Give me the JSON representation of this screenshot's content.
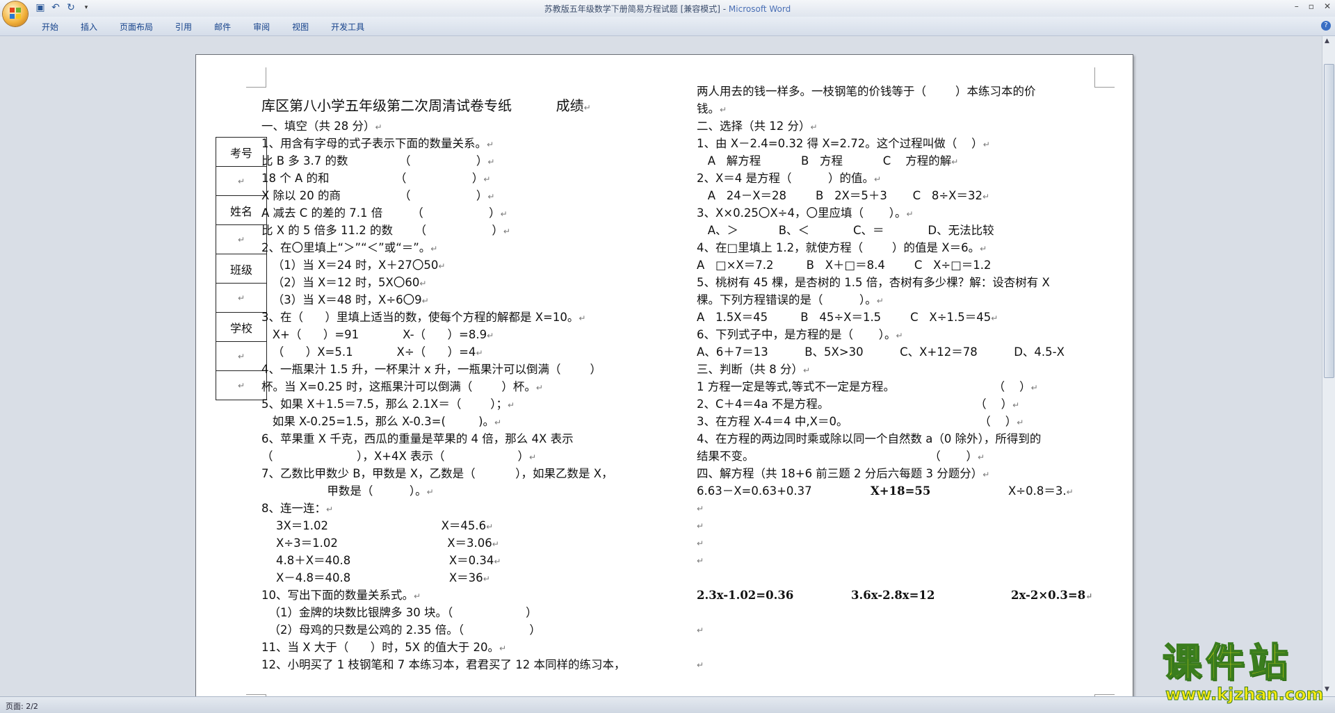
{
  "window": {
    "title": "苏教版五年级数学下册简易方程试题 [兼容模式] - ",
    "app_name": "Microsoft Word"
  },
  "ribbon_tabs": [
    "开始",
    "插入",
    "页面布局",
    "引用",
    "邮件",
    "审阅",
    "视图",
    "开发工具"
  ],
  "status": {
    "page": "页面: 2/2"
  },
  "side_table": [
    "考号",
    "",
    "姓名",
    "",
    "班级",
    "",
    "学校",
    "",
    ""
  ],
  "left_lines": [
    "1、用含有字母的式子表示下面的数量关系。",
    "比 B 多 3.7 的数              （                  ）",
    "18 个 A 的和                  （                  ）",
    "X 除以 20 的商                （                  ）",
    "A 减去 C 的差的 7.1 倍        （                  ）",
    "比 X 的 5 倍多 11.2 的数      （                  ）",
    "2、在〇里填上“＞”“＜”或“＝”。",
    "   （1）当 X＝24 时，X＋27〇50",
    "   （2）当 X＝12 时，5X〇60",
    "   （3）当 X＝48 时，X÷6〇9",
    "3、在（      ）里填上适当的数，使每个方程的解都是 X=10。",
    "   X+（      ）=91            X-（      ）=8.9",
    "   （      ）X=5.1            X÷（      ）=4",
    "4、一瓶果汁 1.5 升，一杯果汁 x 升，一瓶果汁可以倒满（        ）",
    "杯。当 X=0.25 时，这瓶果汁可以倒满（        ）杯。",
    "5、如果 X＋1.5＝7.5，那么 2.1X＝（        ）；",
    "   如果 X-0.25=1.5，那么 X-0.3=(         )。",
    "6、苹果重 X 千克，西瓜的重量是苹果的 4 倍，那么 4X 表示",
    "（                       ），X+4X 表示（                    ）",
    "7、乙数比甲数少 B，甲数是 X，乙数是（           ），如果乙数是 X，",
    "                  甲数是（          ）。",
    "8、连一连：",
    "    3X＝1.02                               X＝45.6",
    "    X÷3＝1.02                              X＝3.06",
    "    4.8＋X＝40.8                           X＝0.34",
    "    X－4.8＝40.8                           X＝36",
    "10、写出下面的数量关系式。",
    "  （1）金牌的块数比银牌多 30 块。（                    ）",
    "  （2）母鸡的只数是公鸡的 2.35 倍。（                  ）",
    "11、当 X 大于（      ）时，5X 的值大于 20。",
    "12、小明买了 1 枝钢笔和 7 本练习本，君君买了 12 本同样的练习本，"
  ],
  "right_lines": [
    "两人用去的钱一样多。一枝钢笔的价钱等于（        ）本练习本的价",
    "钱。",
    "二、选择（共 12 分）",
    "1、由 X－2.4=0.32 得 X=2.72。这个过程叫做（    ）",
    "   A   解方程           B   方程           C    方程的解",
    "2、X＝4 是方程（          ）的值。",
    "   A   24－X＝28        B   2X＝5＋3       C   8÷X＝32",
    "3、X×0.25〇X÷4，〇里应填（       ）。",
    "   A、＞           B、＜            C、＝            D、无法比较",
    "4、在□里填上 1.2，就使方程（        ）的值是 X＝6。",
    "A   □×X＝7.2         B   X＋□＝8.4        C   X÷□＝1.2",
    "5、桃树有 45 棵，是杏树的 1.5 倍，杏树有多少棵？解：设杏树有 X",
    "棵。下列方程错误的是（          ）。",
    "A   1.5X＝45         B   45÷X＝1.5        C   X÷1.5＝45",
    "6、下列式子中，是方程的是（       ）。",
    "A、6＋7＝13          B、5X>30          C、X+12＝78          D、4.5-X",
    "三、判断（共 8 分）",
    "1 方程一定是等式,等式不一定是方程。                           （    ）",
    "2、C＋4＝4a 不是方程。                                        （    ）",
    "3、在方程 X-4＝4 中,X＝0。                                    （    ）",
    "4、在方程的两边同时乘或除以同一个自然数 a（0 除外），所得到的",
    "结果不变。                                                （       ）",
    "四、解方程（共 18+6 前三题 2 分后六每题 3 分题分）",
    "6.63－X=0.63+0.37",
    "X+18=55",
    "X÷0.8＝3.",
    "2.3x-1.02=0.36",
    "3.6x-2.8x=12",
    "2x-2×0.3=8"
  ],
  "doc": {
    "heading": "库区第八小学五年级第二次周清试卷专纸          成绩",
    "section1": "一、填空（共 28 分）",
    "mark": "↵"
  },
  "watermark": {
    "text": "课件站",
    "url": "www.kjzhan.com"
  }
}
